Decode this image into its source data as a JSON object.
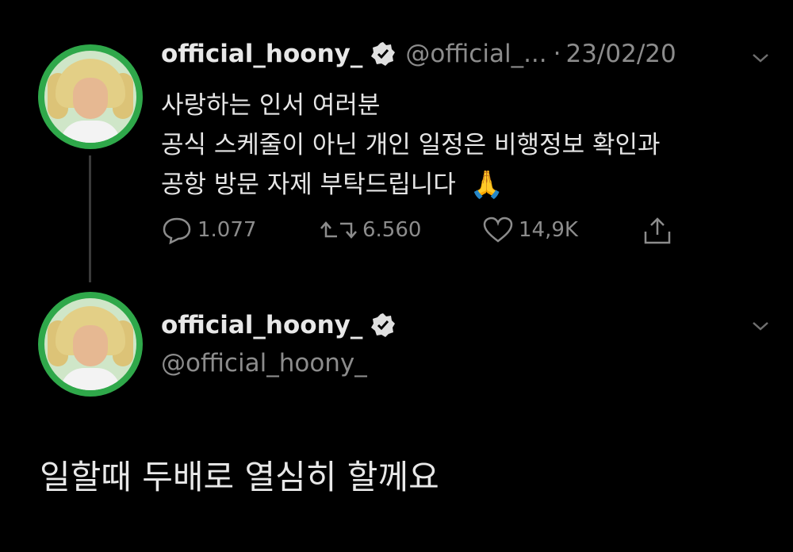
{
  "colors": {
    "background": "#000000",
    "text_primary": "#e6e6e6",
    "text_secondary": "#8c8c8c",
    "avatar_ring": "#2fa84a",
    "thread_line": "#3a3a3a"
  },
  "tweet1": {
    "display_name": "official_hoony_",
    "verified_icon": "verified-badge-icon",
    "handle": "@official_...",
    "separator": "·",
    "date": "23/02/20",
    "lines": [
      "사랑하는 인서 여러분",
      "공식 스케줄이 아닌 개인 일정은 비행정보 확인과",
      "공항 방문 자제 부탁드립니다"
    ],
    "emoji": "🙏",
    "actions": {
      "reply_icon": "reply-icon",
      "reply_count": "1.077",
      "retweet_icon": "retweet-icon",
      "retweet_count": "6.560",
      "like_icon": "heart-icon",
      "like_count": "14,9K",
      "share_icon": "share-icon"
    }
  },
  "tweet2": {
    "display_name": "official_hoony_",
    "verified_icon": "verified-badge-icon",
    "handle": "@official_hoony_",
    "text": "일할때 두배로 열심히 할께요"
  }
}
